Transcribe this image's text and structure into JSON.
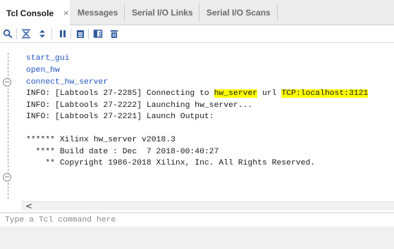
{
  "tabs": [
    {
      "label": "Tcl Console",
      "active": true
    },
    {
      "label": "Messages",
      "active": false
    },
    {
      "label": "Serial I/O Links",
      "active": false
    },
    {
      "label": "Serial I/O Scans",
      "active": false
    }
  ],
  "tab_close_glyph": "×",
  "toolbar": {
    "icons": [
      "search-icon",
      "collapse-all-icon",
      "expand-all-icon",
      "pause-icon",
      "copy-icon",
      "columns-icon",
      "clear-icon"
    ]
  },
  "console": {
    "lines": [
      {
        "kind": "cmd",
        "text": "start_gui"
      },
      {
        "kind": "cmd",
        "text": "open_hw"
      },
      {
        "kind": "cmd",
        "text": "connect_hw_server"
      },
      {
        "kind": "info",
        "pre": "INFO: [Labtools 27-2285] Connecting to ",
        "hl1": "hw_server",
        "mid": " url ",
        "hl2": "TCP:localhost:3121"
      },
      {
        "kind": "info",
        "text": "INFO: [Labtools 27-2222] Launching hw_server..."
      },
      {
        "kind": "info",
        "text": "INFO: [Labtools 27-2221] Launch Output:"
      },
      {
        "kind": "info",
        "text": ""
      },
      {
        "kind": "info",
        "text": "****** Xilinx hw_server v2018.3"
      },
      {
        "kind": "info",
        "text": "  **** Build date : Dec  7 2018-00:40:27"
      },
      {
        "kind": "info",
        "text": "    ** Copyright 1986-2018 Xilinx, Inc. All Rights Reserved."
      }
    ]
  },
  "scroll_left_glyph": "<",
  "input": {
    "placeholder": "Type a Tcl command here",
    "value": ""
  },
  "colors": {
    "command": "#2255c4",
    "highlight": "#ffff00",
    "tab_active_text": "#1a1a1a",
    "tab_inactive_text": "#6b6b6b"
  }
}
